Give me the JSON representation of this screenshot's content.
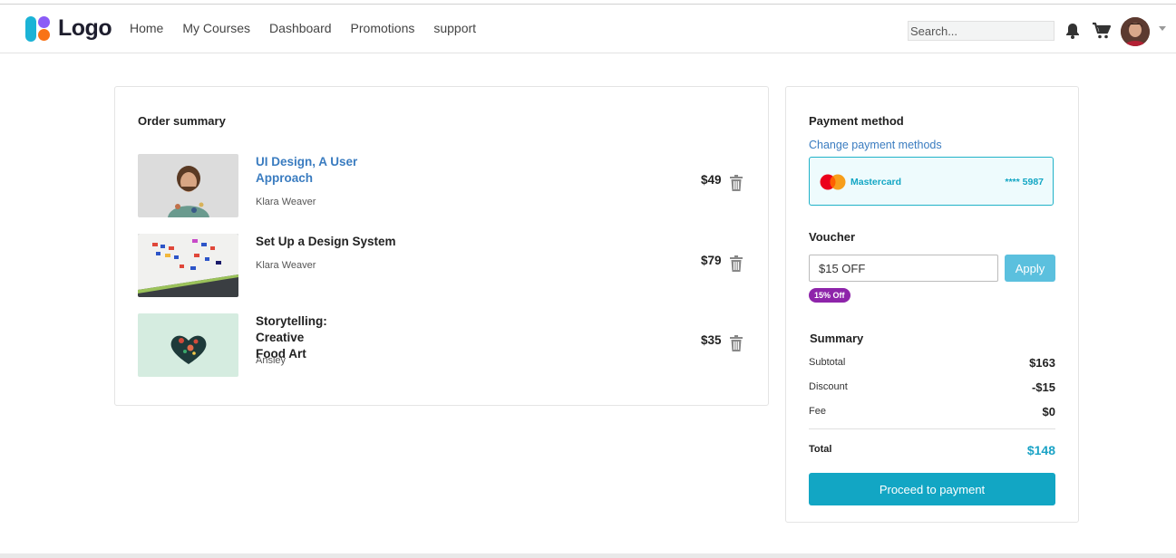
{
  "header": {
    "logo_text": "Logo",
    "nav": [
      "Home",
      "My Courses",
      "Dashboard",
      "Promotions",
      "support"
    ],
    "search_placeholder": "Search..."
  },
  "order": {
    "title": "Order summary",
    "items": [
      {
        "title_line1": "UI Design, A User",
        "title_line2": "Approach",
        "author": "Klara Weaver",
        "price": "$49",
        "image": "smiling-man-photo"
      },
      {
        "title_line1": "Set Up a Design System",
        "title_line2": "",
        "author": "Klara Weaver",
        "price": "$79",
        "image": "design-palette-photo"
      },
      {
        "title_line1": "Storytelling: Creative",
        "title_line2": "Food Art",
        "author": "Ansley",
        "price": "$35",
        "image": "heart-bowl-photo"
      }
    ]
  },
  "payment": {
    "title": "Payment method",
    "change_link": "Change payment methods",
    "card_brand": "Mastercard",
    "card_number": "**** 5987"
  },
  "voucher": {
    "title": "Voucher",
    "value": "$15 OFF",
    "apply_label": "Apply",
    "badge": "15% Off"
  },
  "summary": {
    "title": "Summary",
    "rows": [
      {
        "label": "Subtotal",
        "value": "$163"
      },
      {
        "label": "Discount",
        "value": "-$15"
      },
      {
        "label": "Fee",
        "value": "$0"
      }
    ],
    "total_label": "Total",
    "total_value": "$148",
    "proceed_label": "Proceed to payment"
  },
  "colors": {
    "accent": "#12a6c4",
    "link": "#3a7cc0",
    "badge": "#8e24aa",
    "apply": "#5bc0de"
  }
}
